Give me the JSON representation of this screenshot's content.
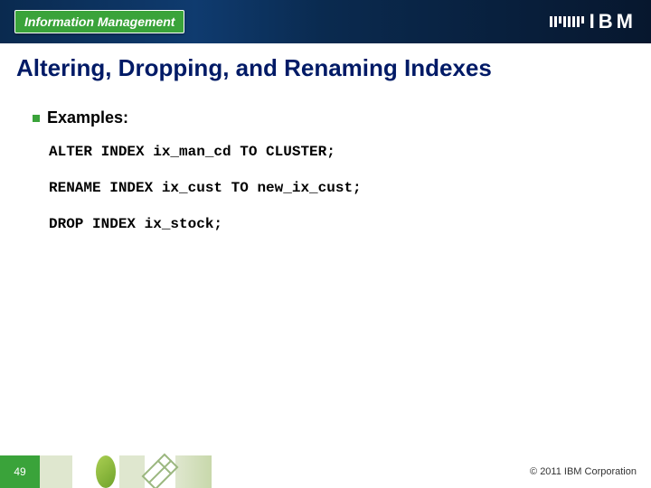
{
  "header": {
    "badge_text": "Information Management",
    "logo_text": "IBM"
  },
  "title": "Altering, Dropping, and Renaming Indexes",
  "body": {
    "bullet_label": "Examples:",
    "code_lines": [
      "ALTER INDEX ix_man_cd TO CLUSTER;",
      "RENAME INDEX ix_cust TO new_ix_cust;",
      "DROP INDEX ix_stock;"
    ]
  },
  "footer": {
    "slide_number": "49",
    "copyright": "© 2011 IBM Corporation"
  }
}
